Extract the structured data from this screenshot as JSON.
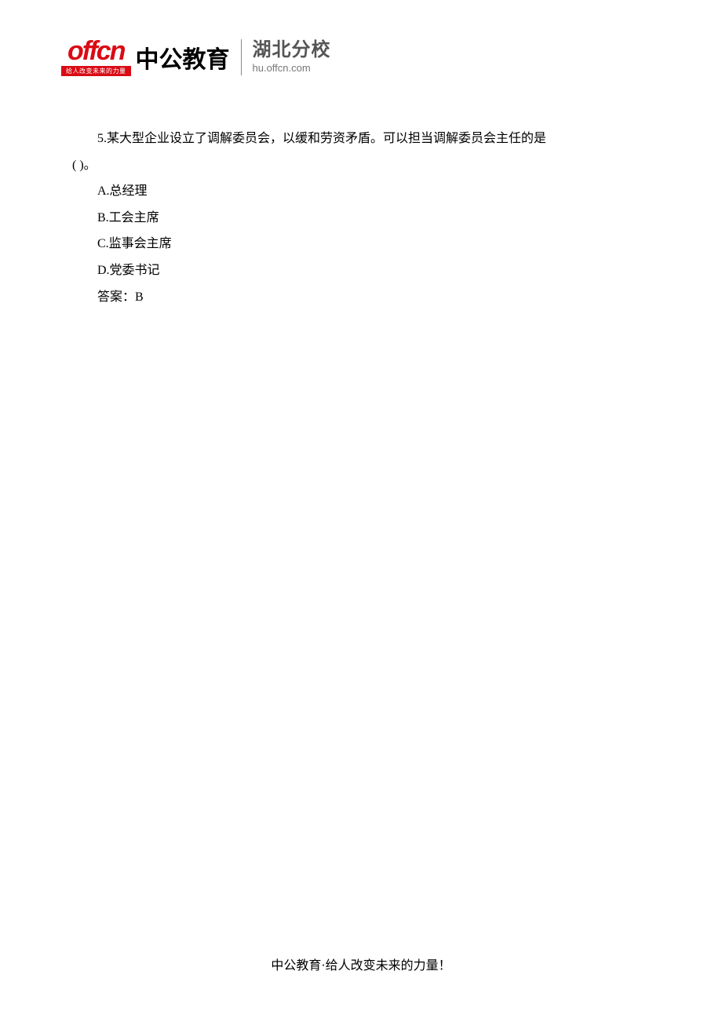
{
  "header": {
    "logo_main": "offcn",
    "logo_tagline": "给人改变未来的力量",
    "logo_cn": "中公教育",
    "branch_name": "湖北分校",
    "branch_url": "hu.offcn.com"
  },
  "question": {
    "number_text": "5.某大型企业设立了调解委员会，以缓和劳资矛盾。可以担当调解委员会主任的是",
    "blank_line": "(   )。",
    "options": {
      "a": "A.总经理",
      "b": "B.工会主席",
      "c": "C.监事会主席",
      "d": "D.党委书记"
    },
    "answer_label": "答案：B"
  },
  "footer": {
    "text": "中公教育·给人改变未来的力量！"
  }
}
